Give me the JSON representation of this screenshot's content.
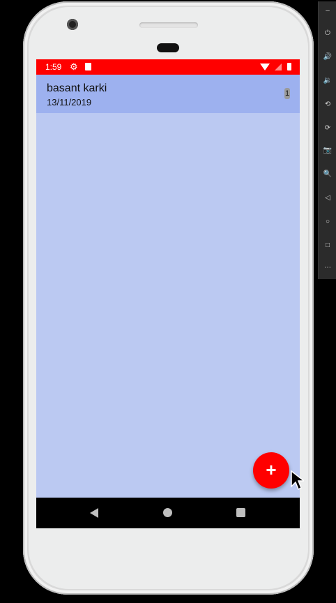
{
  "status_bar": {
    "time": "1:59",
    "icons": [
      "gear-icon",
      "sdcard-icon",
      "wifi-icon",
      "signal-icon",
      "battery-icon"
    ]
  },
  "list": {
    "items": [
      {
        "name": "basant karki",
        "date": "13/11/2019",
        "badge": "1"
      }
    ]
  },
  "fab": {
    "label": "+"
  },
  "navigation": {
    "icons": [
      "back-icon",
      "home-icon",
      "recents-icon"
    ]
  },
  "emulator_toolbar": {
    "buttons": [
      "minimize-icon",
      "power-icon",
      "volume-up-icon",
      "volume-down-icon",
      "rotate-left-icon",
      "rotate-right-icon",
      "camera-icon",
      "zoom-icon",
      "back-icon",
      "home-icon",
      "overview-icon",
      "more-icon"
    ]
  },
  "colors": {
    "status_bar": "#ff0000",
    "background": "#bbc9f2",
    "list_item": "#9db1ef",
    "fab": "#ff0000"
  }
}
